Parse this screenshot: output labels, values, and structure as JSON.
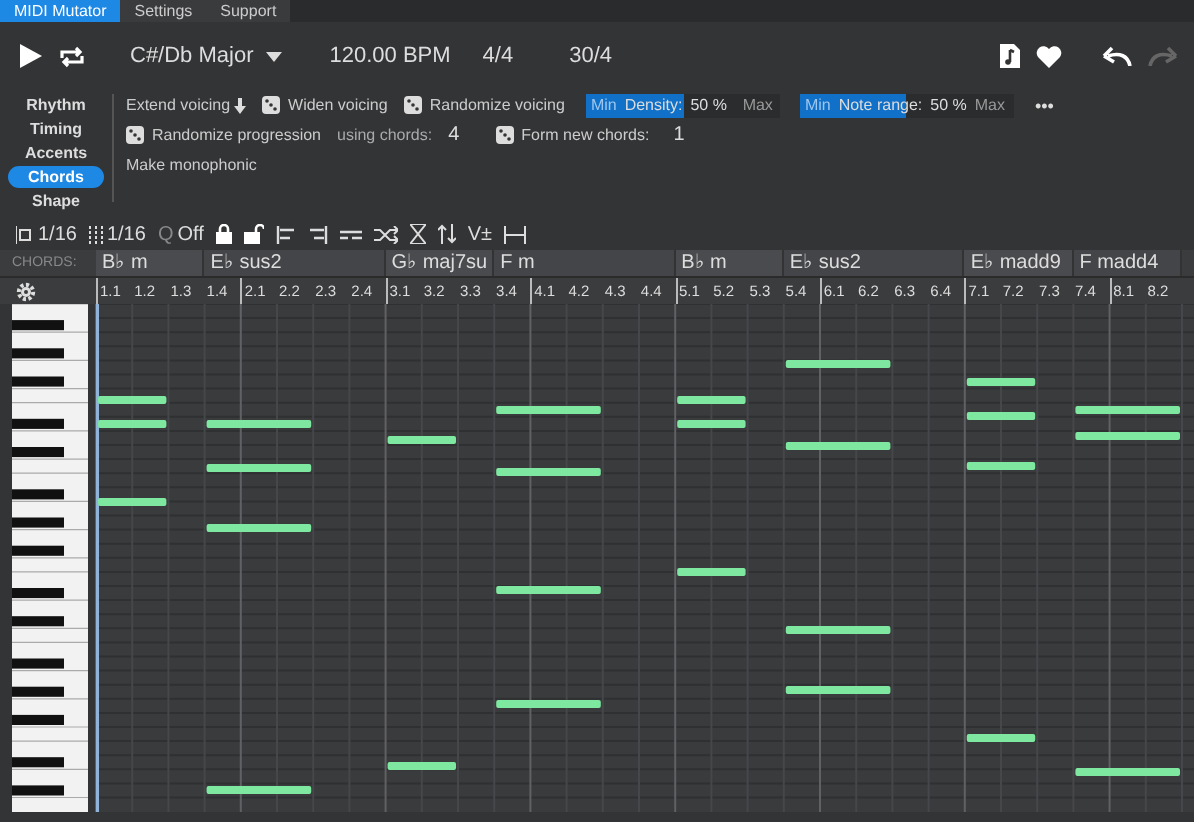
{
  "tabs": [
    {
      "label": "MIDI Mutator",
      "selected": true
    },
    {
      "label": "Settings",
      "selected": false
    },
    {
      "label": "Support",
      "selected": false
    }
  ],
  "toolbar": {
    "key": "C#/Db Major",
    "tempo": "120.00 BPM",
    "time_signature": "4/4",
    "length": "30/4",
    "redo_disabled": true
  },
  "sidebar": {
    "items": [
      {
        "label": "Rhythm",
        "selected": false
      },
      {
        "label": "Timing",
        "selected": false
      },
      {
        "label": "Accents",
        "selected": false
      },
      {
        "label": "Chords",
        "selected": true
      },
      {
        "label": "Shape",
        "selected": false
      }
    ]
  },
  "options": {
    "extend_voicing": "Extend voicing",
    "widen_voicing": "Widen voicing",
    "randomize_voicing": "Randomize voicing",
    "sliders": [
      {
        "min": "Min",
        "label": "Density:",
        "reading": "50 %",
        "max": "Max",
        "level": 0.5
      },
      {
        "min": "Min",
        "label": "Note range:",
        "reading": "50 %",
        "max": "Max",
        "level": 0.5
      }
    ],
    "more": "•••",
    "randomize_progression": "Randomize progression",
    "using_chords_label": "using chords:",
    "using_chords_value": "4",
    "form_new_label": "Form new chords:",
    "form_new_value": "1",
    "make_monophonic": "Make monophonic"
  },
  "grid_toolbar": {
    "step": "1/16",
    "grid": "1/16",
    "quantize_icon": "Q",
    "quantize": "Off",
    "velocity": "V±"
  },
  "chords_label": "CHORDS:",
  "chords": [
    {
      "name": "B♭ m"
    },
    {
      "name": "E♭ sus2"
    },
    {
      "name": "G♭ maj7su"
    },
    {
      "name": "F m"
    },
    {
      "name": "B♭ m"
    },
    {
      "name": "E♭ sus2"
    },
    {
      "name": "E♭ madd9"
    },
    {
      "name": "F madd4"
    }
  ],
  "ruler": [
    "1.1",
    "1.2",
    "1.3",
    "1.4",
    "2.1",
    "2.2",
    "2.3",
    "2.4",
    "3.1",
    "3.2",
    "3.3",
    "3.4",
    "4.1",
    "4.2",
    "4.3",
    "4.4",
    "5.1",
    "5.2",
    "5.3",
    "5.4",
    "6.1",
    "6.2",
    "6.3",
    "6.4",
    "7.1",
    "7.2",
    "7.3",
    "7.4",
    "8.1",
    "8.2"
  ]
}
